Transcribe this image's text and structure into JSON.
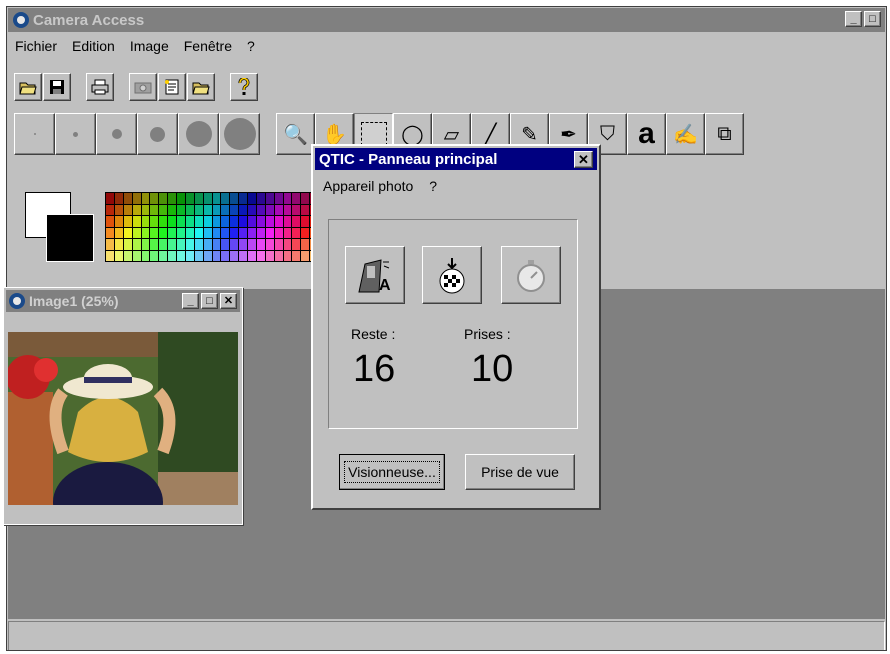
{
  "app": {
    "title": "Camera Access",
    "min": "_",
    "max": "□"
  },
  "menu": [
    "Fichier",
    "Edition",
    "Image",
    "Fenêtre",
    "?"
  ],
  "icons": {
    "toolbar": [
      "open-folder-icon",
      "save-icon",
      "print-icon",
      "camera-icon",
      "acquire-icon",
      "open-icon",
      "help-icon"
    ],
    "tools": [
      "zoom-icon",
      "hand-icon",
      "select-rect-icon",
      "lasso-icon",
      "eraser-icon",
      "brush-icon",
      "pencil-icon",
      "dropper-icon",
      "fill-icon",
      "text-icon",
      "smudge-icon",
      "copy-icon"
    ]
  },
  "tool_glyphs": [
    "🔍",
    "✋",
    "",
    "◯",
    "▱",
    "╱",
    "✎",
    "✒",
    "⛉",
    "a",
    "✍",
    "⧉"
  ],
  "colors": {
    "titlebar_active": "#000080",
    "window_bg": "#c0c0c0",
    "workspace": "#808080"
  },
  "image_window": {
    "title": "Image1 (25%)"
  },
  "dialog": {
    "title": "QTIC - Panneau principal",
    "close": "✕",
    "menu": [
      "Appareil photo",
      "?"
    ],
    "remaining_label": "Reste :",
    "remaining_value": "16",
    "taken_label": "Prises :",
    "taken_value": "10",
    "viewer_button": "Visionneuse...",
    "shoot_button": "Prise de vue"
  }
}
